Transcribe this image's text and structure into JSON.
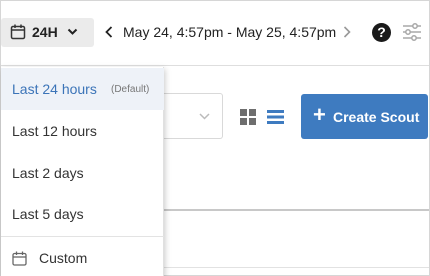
{
  "toolbar": {
    "range_label": "24H",
    "date_range": "May 24, 4:57pm - May 25, 4:57pm",
    "help_symbol": "?"
  },
  "content": {
    "create_button_label": "Create Scout",
    "create_button_plus": "+"
  },
  "menu": {
    "items": [
      {
        "label": "Last 24 hours",
        "tag": "(Default)",
        "selected": true
      },
      {
        "label": "Last 12 hours"
      },
      {
        "label": "Last 2 days"
      },
      {
        "label": "Last 5 days"
      },
      {
        "label": "Custom"
      }
    ]
  },
  "colors": {
    "accent": "#3e7bc0",
    "selected_text": "#3b74b8",
    "selected_bg": "#eef2f8",
    "button_bg": "#ebebeb"
  },
  "icons": [
    "calendar-icon",
    "chevron-down-icon",
    "chevron-left-icon",
    "chevron-right-icon",
    "help-icon",
    "sliders-icon",
    "grid-view-icon",
    "list-view-icon",
    "plus-icon"
  ]
}
